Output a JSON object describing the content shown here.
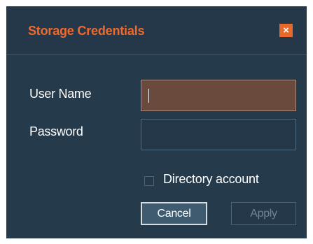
{
  "dialog": {
    "title": "Storage Credentials",
    "close_label": "×"
  },
  "form": {
    "username": {
      "label": "User Name",
      "value": "",
      "placeholder": ""
    },
    "password": {
      "label": "Password",
      "value": "",
      "placeholder": ""
    },
    "directory_account": {
      "label": "Directory account",
      "checked": false
    }
  },
  "buttons": {
    "cancel_label": "Cancel",
    "apply_label": "Apply"
  },
  "colors": {
    "background": "#253a4b",
    "accent": "#ee6a2e",
    "active_input": "#6b4a3e",
    "disabled_text": "#6f8596"
  }
}
